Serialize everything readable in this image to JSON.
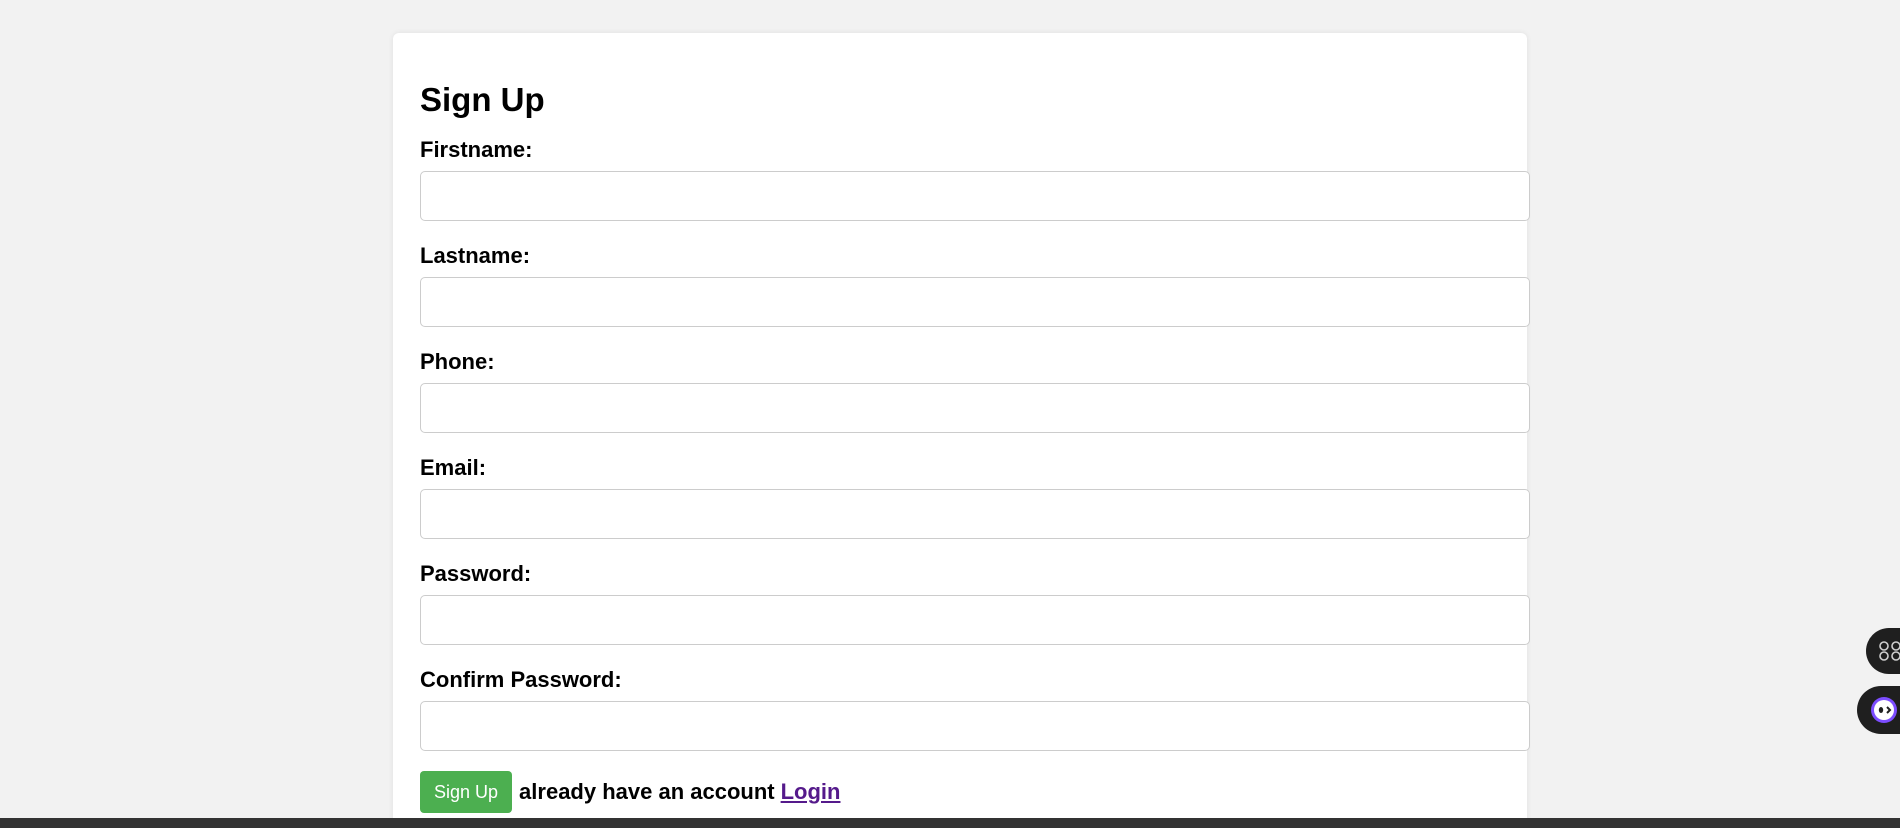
{
  "form": {
    "title": "Sign Up",
    "fields": [
      {
        "label": "Firstname:",
        "value": "",
        "placeholder": ""
      },
      {
        "label": "Lastname:",
        "value": "",
        "placeholder": ""
      },
      {
        "label": "Phone:",
        "value": "",
        "placeholder": ""
      },
      {
        "label": "Email:",
        "value": "",
        "placeholder": ""
      },
      {
        "label": "Password:",
        "value": "",
        "placeholder": ""
      },
      {
        "label": "Confirm Password:",
        "value": "",
        "placeholder": ""
      }
    ],
    "submit_label": "Sign Up",
    "already_text": "already have an account",
    "login_label": "Login"
  },
  "colors": {
    "background": "#f2f2f2",
    "card": "#ffffff",
    "button": "#4caf50",
    "link": "#551a8b"
  },
  "floating_widgets": [
    {
      "icon": "apps-grid-icon"
    },
    {
      "icon": "assistant-bot-icon"
    }
  ]
}
